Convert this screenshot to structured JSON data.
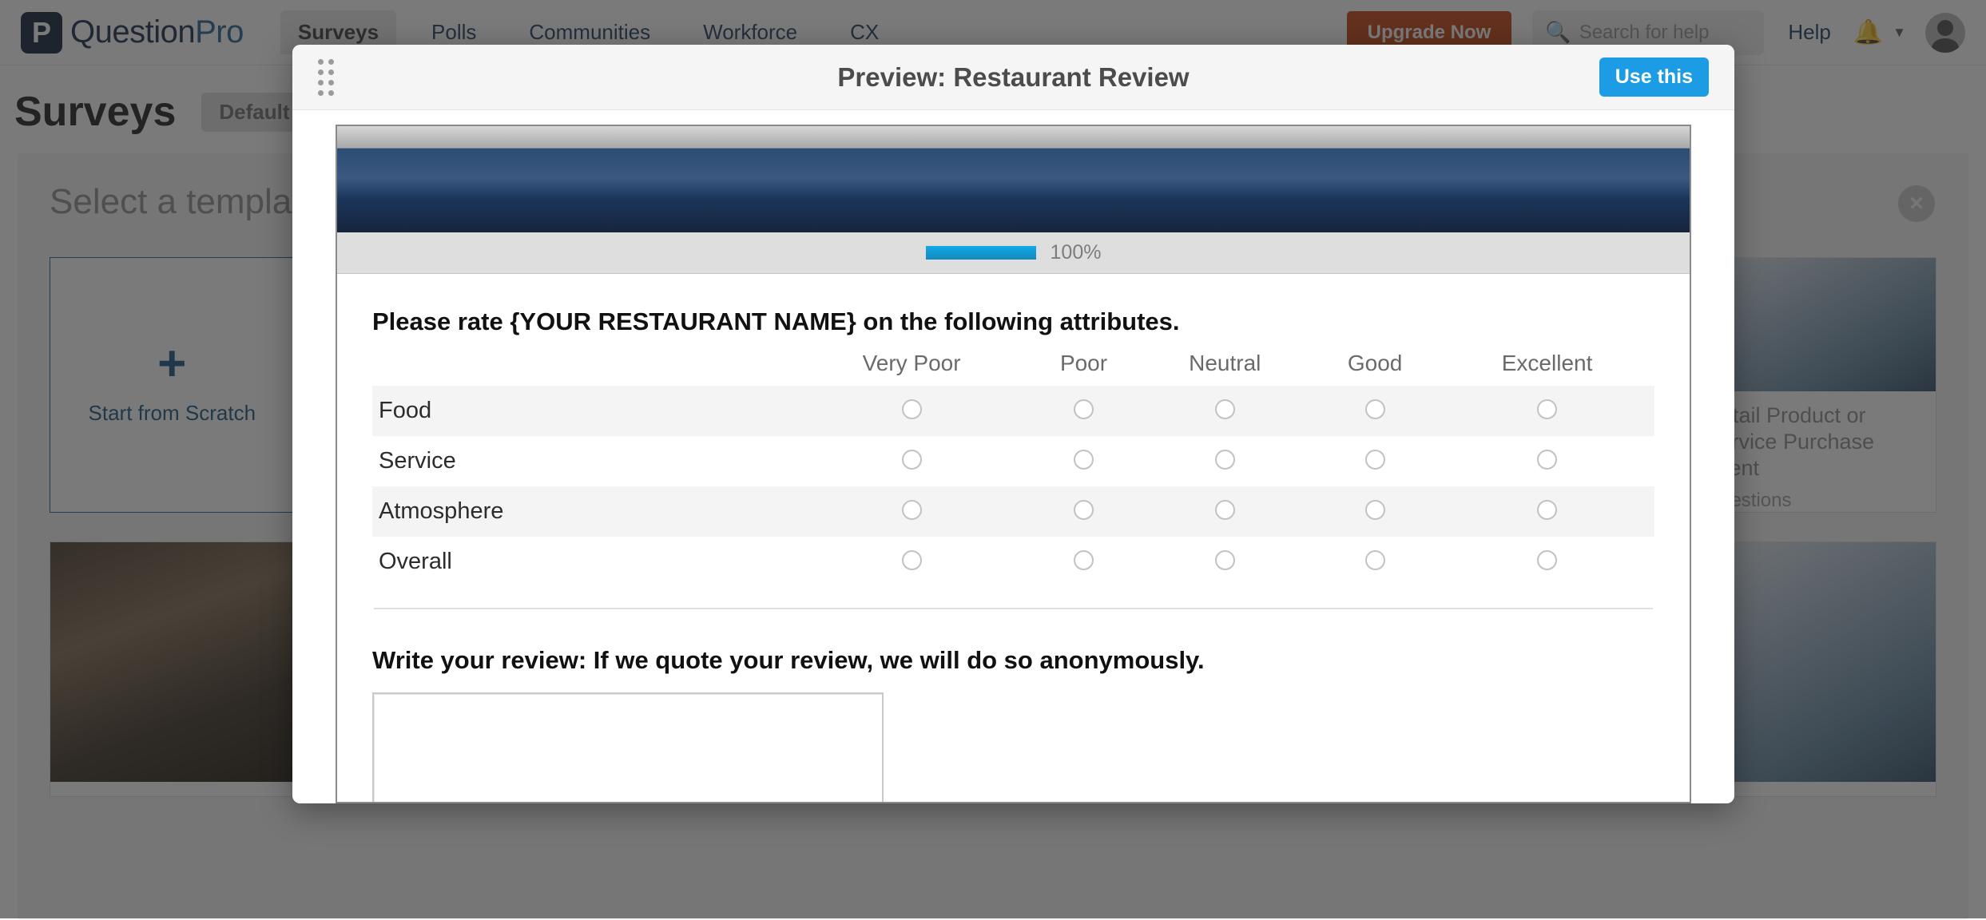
{
  "topnav": {
    "brand": {
      "mark": "P",
      "name_part1": "Question",
      "name_part2": "Pro"
    },
    "items": [
      {
        "label": "Surveys",
        "active": true
      },
      {
        "label": "Polls",
        "active": false
      },
      {
        "label": "Communities",
        "active": false
      },
      {
        "label": "Workforce",
        "active": false
      },
      {
        "label": "CX",
        "active": false
      }
    ],
    "upgrade_label": "Upgrade Now",
    "search_placeholder": "Search for help",
    "search_icon": "search-icon",
    "help_label": "Help",
    "bell_icon": "bell-icon",
    "caret_icon": "chevron-down-icon",
    "avatar_icon": "user-avatar-icon"
  },
  "page": {
    "title": "Surveys",
    "default_pill": "Default",
    "panel_title": "Select a template or import from Microsoft Word",
    "close_icon": "close-icon",
    "scratch_card": {
      "plus_icon": "plus-icon",
      "label": "Start from Scratch"
    },
    "templates": [
      {
        "name": "Retail Product or Service Purchase Intent",
        "questions": "Questions"
      },
      {
        "name": "",
        "questions": ""
      },
      {
        "name": "",
        "questions": ""
      },
      {
        "name": "",
        "questions": ""
      },
      {
        "name": "",
        "questions": ""
      },
      {
        "name": "",
        "questions": ""
      }
    ]
  },
  "modal": {
    "drag_handle_icon": "drag-handle-icon",
    "title": "Preview: Restaurant Review",
    "use_this_label": "Use this",
    "survey": {
      "progress_percent": "100%",
      "progress_value": 100,
      "question1": "Please rate {YOUR RESTAURANT NAME} on the following attributes.",
      "matrix": {
        "columns": [
          "Very Poor",
          "Poor",
          "Neutral",
          "Good",
          "Excellent"
        ],
        "rows": [
          "Food",
          "Service",
          "Atmosphere",
          "Overall"
        ],
        "selected": [
          null,
          null,
          null,
          null
        ]
      },
      "question2": "Write your review: If we quote your review, we will do so anonymously.",
      "answer_value": ""
    }
  },
  "colors": {
    "accent_blue": "#1c9ce5",
    "brand_navy": "#13294b",
    "upgrade_orange": "#c2410c",
    "survey_header_navy": "#1b355a"
  }
}
